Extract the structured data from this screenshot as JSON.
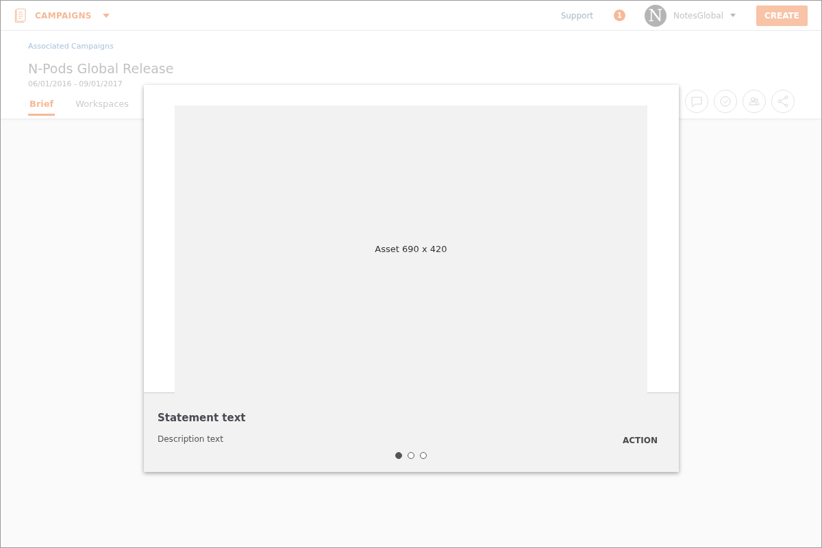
{
  "header": {
    "section": "CAMPAIGNS",
    "support": "Support",
    "notifications": "1",
    "avatar_letter": "N",
    "account": "NotesGlobal",
    "create": "CREATE"
  },
  "breadcrumb": "Associated Campaigns",
  "title": "N-Pods Global Release",
  "dates": "06/01/2016 - 09/01/2017",
  "tabs": [
    {
      "label": "Brief",
      "selected": true
    },
    {
      "label": "Workspaces",
      "selected": false
    }
  ],
  "actions": [
    {
      "kind": "comment"
    },
    {
      "kind": "approve"
    },
    {
      "kind": "people"
    },
    {
      "kind": "share"
    }
  ],
  "modal": {
    "asset": "Asset 690 x 420",
    "statement": "Statement text",
    "description": "Description text",
    "action": "ACTION",
    "dots": [
      {
        "selected": true
      },
      {
        "selected": false
      },
      {
        "selected": false
      }
    ]
  }
}
